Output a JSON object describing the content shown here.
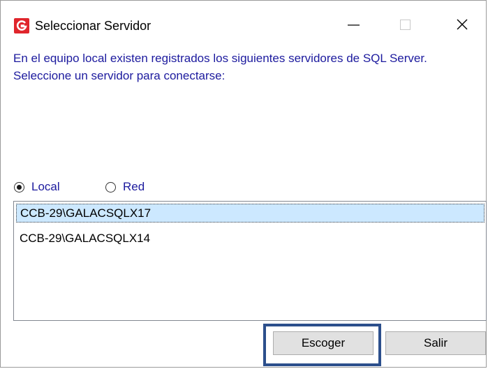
{
  "window": {
    "title": "Seleccionar Servidor",
    "icon": "galac-g-icon"
  },
  "title_controls": {
    "minimize": "minimize-icon",
    "maximize": "maximize-icon",
    "close": "close-icon"
  },
  "message": {
    "line1": "En el equipo local existen registrados los siguientes servidores de SQL Server.",
    "line2": "Seleccione un servidor para conectarse:"
  },
  "scope": {
    "options": [
      {
        "label": "Local",
        "checked": true
      },
      {
        "label": "Red",
        "checked": false
      }
    ]
  },
  "servers": {
    "items": [
      {
        "label": "CCB-29\\GALACSQLX17",
        "selected": true
      },
      {
        "label": "CCB-29\\GALACSQLX14",
        "selected": false
      }
    ]
  },
  "buttons": {
    "choose_label": "Escoger",
    "exit_label": "Salir"
  },
  "colors": {
    "text_blue": "#1c1a9e",
    "selection": "#cce8ff",
    "highlight_border": "#2c4f8c",
    "icon_red": "#e0252c"
  }
}
